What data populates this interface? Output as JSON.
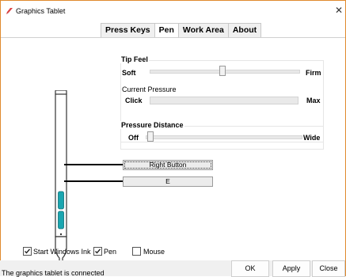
{
  "window": {
    "title": "Graphics Tablet",
    "close_glyph": "✕",
    "accent": "#e08a2e"
  },
  "tabs": [
    {
      "label": "Press Keys"
    },
    {
      "label": "Pen",
      "active": true
    },
    {
      "label": "Work Area"
    },
    {
      "label": "About"
    }
  ],
  "tip_feel": {
    "title": "Tip Feel",
    "left_label": "Soft",
    "right_label": "Firm",
    "level": 0.49,
    "current_pressure_label": "Current Pressure",
    "pressure_left_label": "Click",
    "pressure_right_label": "Max",
    "current_pressure_level": 0
  },
  "pressure_distance": {
    "title": "Pressure Distance",
    "left_label": "Off",
    "right_label": "Wide",
    "level": 0.0
  },
  "pen_buttons": {
    "upper": "Right Button",
    "lower": "E",
    "pen_color": "#1aa6b0"
  },
  "options": {
    "windows_ink": {
      "label": "Start Windows Ink",
      "checked": true
    },
    "pen": {
      "label": "Pen",
      "checked": true
    },
    "mouse": {
      "label": "Mouse",
      "checked": false
    }
  },
  "footer": {
    "status": "The graphics tablet is connected",
    "ok": "OK",
    "apply": "Apply",
    "close": "Close"
  }
}
